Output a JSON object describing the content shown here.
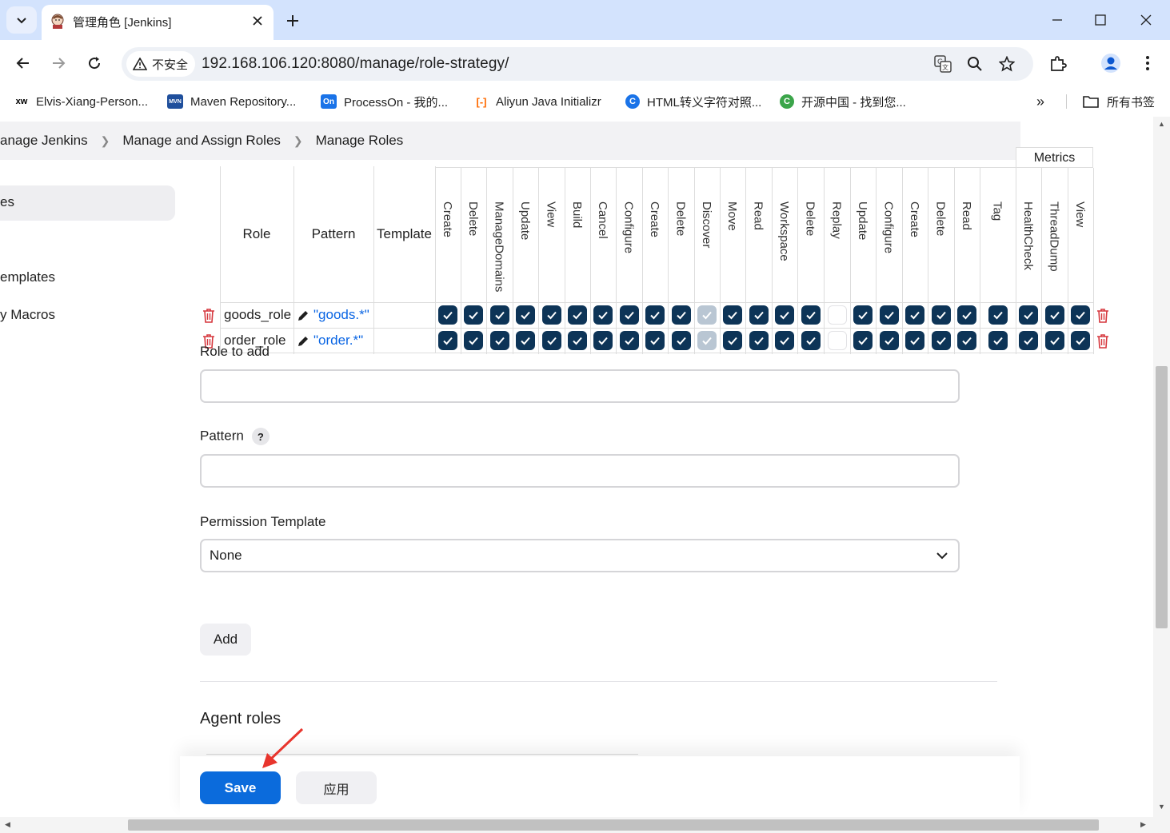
{
  "browser": {
    "tab_title": "管理角色 [Jenkins]",
    "security_label": "不安全",
    "url": "192.168.106.120:8080/manage/role-strategy/",
    "bookmarks": [
      {
        "label": "Elvis-Xiang-Person...",
        "icon": "xw-icon",
        "color": "#000000"
      },
      {
        "label": "Maven Repository...",
        "icon": "maven-icon",
        "color": "#1f4f9c"
      },
      {
        "label": "ProcessOn - 我的...",
        "icon": "processon-icon",
        "color": "#1a73e8"
      },
      {
        "label": "Aliyun Java Initializr",
        "icon": "aliyun-icon",
        "color": "#ff6a00"
      },
      {
        "label": "HTML转义字符对照...",
        "icon": "html-icon",
        "color": "#1a73e8"
      },
      {
        "label": "开源中国 - 找到您...",
        "icon": "oschina-icon",
        "color": "#3ba54a"
      }
    ],
    "all_bookmarks": "所有书签"
  },
  "breadcrumb": [
    "anage Jenkins",
    "Manage and Assign Roles",
    "Manage Roles"
  ],
  "sidebar": {
    "items": [
      "es",
      "emplates",
      "y Macros"
    ]
  },
  "table": {
    "col_role": "Role",
    "col_pattern": "Pattern",
    "col_template": "Template",
    "group_metrics": "Metrics",
    "permissions": [
      "Create",
      "Delete",
      "ManageDomains",
      "Update",
      "View",
      "Build",
      "Cancel",
      "Configure",
      "Create",
      "Delete",
      "Discover",
      "Move",
      "Read",
      "Workspace",
      "Delete",
      "Replay",
      "Update",
      "Configure",
      "Create",
      "Delete",
      "Read",
      "Tag",
      "HealthCheck",
      "ThreadDump",
      "View"
    ],
    "rows": [
      {
        "role": "goods_role",
        "pattern": "\"goods.*\"",
        "states": [
          "on",
          "on",
          "on",
          "on",
          "on",
          "on",
          "on",
          "on",
          "on",
          "on",
          "disabled",
          "on",
          "on",
          "on",
          "on",
          "off",
          "on",
          "on",
          "on",
          "on",
          "on",
          "on",
          "on",
          "on",
          "on"
        ]
      },
      {
        "role": "order_role",
        "pattern": "\"order.*\"",
        "states": [
          "on",
          "on",
          "on",
          "on",
          "on",
          "on",
          "on",
          "on",
          "on",
          "on",
          "disabled",
          "on",
          "on",
          "on",
          "on",
          "off",
          "on",
          "on",
          "on",
          "on",
          "on",
          "on",
          "on",
          "on",
          "on"
        ]
      }
    ]
  },
  "form": {
    "role_to_add_label": "Role to add",
    "role_to_add_value": "",
    "pattern_label": "Pattern",
    "pattern_help": "?",
    "pattern_value": "",
    "permission_template_label": "Permission Template",
    "permission_template_value": "None",
    "add_button": "Add"
  },
  "agent_roles_title": "Agent roles",
  "actions": {
    "save": "Save",
    "apply": "应用"
  },
  "colors": {
    "checkbox_on": "#0d3457",
    "checkbox_disabled": "#b9c6d3",
    "save_button": "#0b6bdc",
    "pattern_link": "#0b66e4",
    "trash": "#d6373d",
    "annotation_arrow": "#e8352d"
  }
}
